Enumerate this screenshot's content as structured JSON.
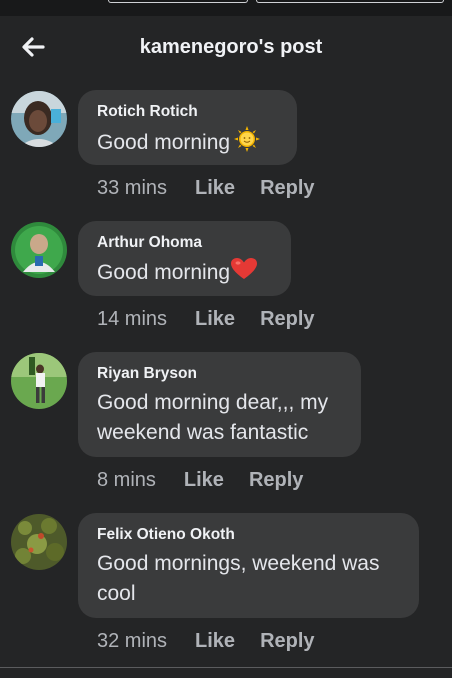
{
  "header": {
    "back_icon": "arrow-left-icon",
    "title": "kamenegoro's post"
  },
  "comments": [
    {
      "author": "Rotich Rotich",
      "text": "Good morning",
      "emoji": "sun-face-emoji",
      "time": "33 mins",
      "like": "Like",
      "reply": "Reply"
    },
    {
      "author": "Arthur Ohoma",
      "text": "Good morning",
      "emoji": "red-heart-emoji",
      "time": "14 mins",
      "like": "Like",
      "reply": "Reply"
    },
    {
      "author": "Riyan Bryson",
      "text_line1": "Good morning dear,,, my",
      "text_line2": "weekend was fantastic",
      "time": "8 mins",
      "like": "Like",
      "reply": "Reply"
    },
    {
      "author": "Felix Otieno Okoth",
      "text_line1": "Good mornings, weekend was",
      "text_line2": "cool",
      "time": "32 mins",
      "like": "Like",
      "reply": "Reply"
    }
  ]
}
